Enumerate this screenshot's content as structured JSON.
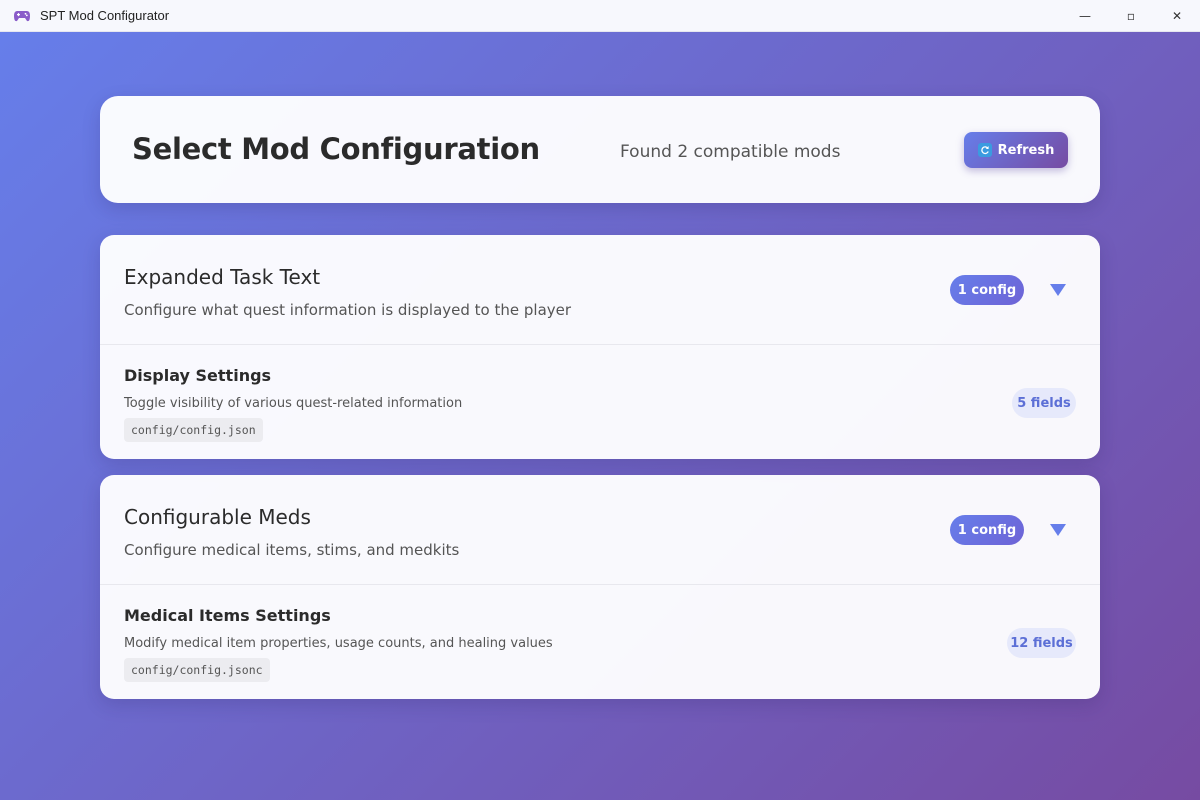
{
  "window": {
    "title": "SPT Mod Configurator",
    "controls": {
      "minimize": "—",
      "maximize": "▫",
      "close": "✕"
    }
  },
  "header": {
    "title": "Select Mod Configuration",
    "found_text": "Found 2 compatible mods",
    "refresh_label": "Refresh",
    "refresh_icon": "🔄"
  },
  "mods": [
    {
      "name": "Expanded Task Text",
      "description": "Configure what quest information is displayed to the player",
      "config_count": "1 config",
      "expand_icon": "▼",
      "configs": [
        {
          "name": "Display Settings",
          "description": "Toggle visibility of various quest-related information",
          "path": "config/config.json",
          "fields": "5 fields"
        }
      ]
    },
    {
      "name": "Configurable Meds",
      "description": "Configure medical items, stims, and medkits",
      "config_count": "1 config",
      "expand_icon": "▼",
      "configs": [
        {
          "name": "Medical Items Settings",
          "description": "Modify medical item properties, usage counts, and healing values",
          "path": "config/config.jsonc",
          "fields": "12 fields"
        }
      ]
    }
  ],
  "colors": {
    "gradient_start": "#667eea",
    "gradient_end": "#764ba2",
    "badge_text": "#5c6fd6"
  }
}
